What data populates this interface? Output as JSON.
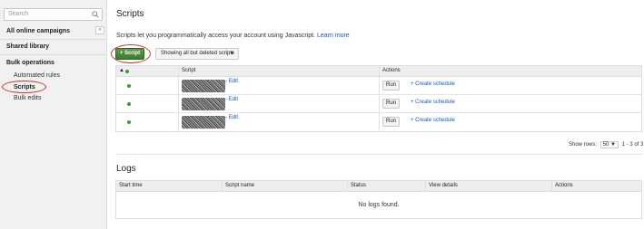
{
  "sidebar": {
    "search_placeholder": "Search",
    "collapse_label": "«",
    "all_campaigns": "All online campaigns",
    "shared_library": "Shared library",
    "bulk_operations": "Bulk operations",
    "sub_items": [
      "Automated rules",
      "Scripts",
      "Bulk edits"
    ]
  },
  "main": {
    "title": "Scripts",
    "description": "Scripts let you programmatically access your account using Javascript.",
    "learn_more": "Learn more",
    "add_button": "+ Script",
    "filter_label": "Showing all but deleted scripts",
    "filter_caret": "▼"
  },
  "scripts_table": {
    "headers": [
      "Script",
      "Actions"
    ],
    "sort_indicator": "▲",
    "rows": [
      {
        "name_link": "Edit",
        "dash": "-",
        "run": "Run",
        "schedule": "+ Create schedule"
      },
      {
        "name_link": "Edit",
        "dash": "-",
        "run": "Run",
        "schedule": "+ Create schedule"
      },
      {
        "name_link": "Edit",
        "dash": "-",
        "run": "Run",
        "schedule": "+ Create schedule"
      }
    ]
  },
  "pager": {
    "show_rows_label": "Show rows:",
    "rows_value": "50",
    "range": "1 - 3 of 3"
  },
  "logs": {
    "title": "Logs",
    "headers": [
      "Start time",
      "Script name",
      "Status",
      "View details",
      "Actions"
    ],
    "empty_message": "No logs found."
  },
  "colors": {
    "accent_green": "#3d7c30",
    "link_blue": "#15c",
    "annotation_red": "#c0392b"
  }
}
